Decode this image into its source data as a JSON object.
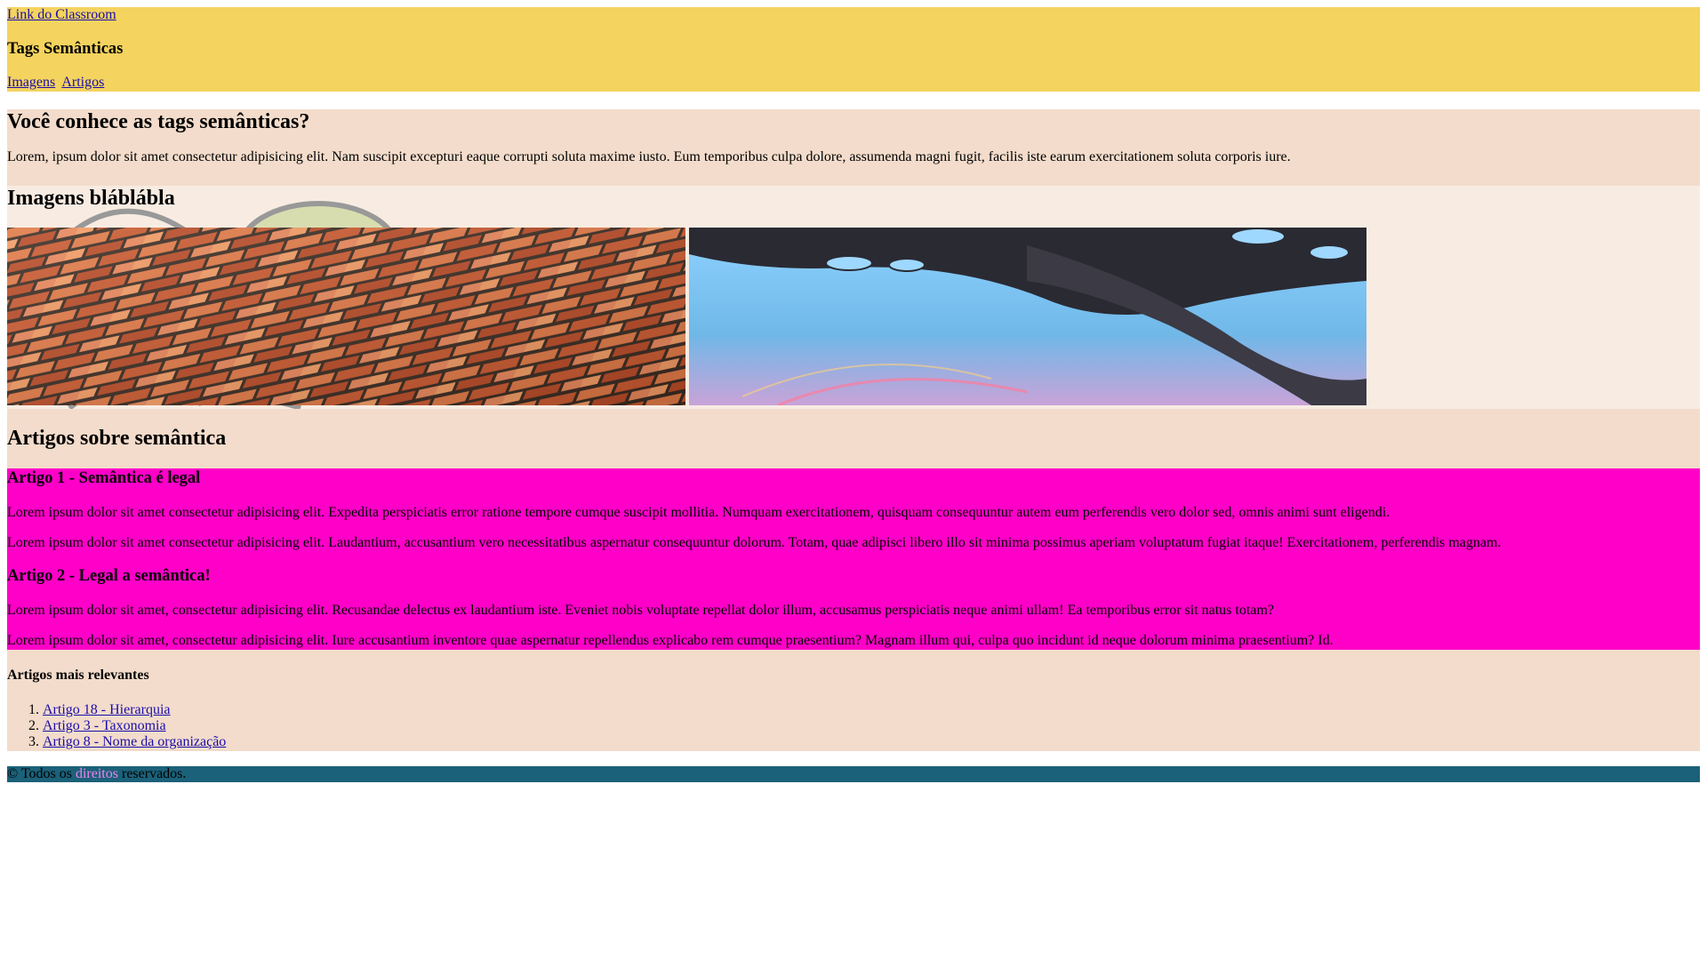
{
  "header": {
    "classroom_link": "Link do Classroom",
    "title": "Tags Semânticas",
    "nav": [
      "Imagens",
      "Artigos"
    ]
  },
  "intro": {
    "heading": "Você conhece as tags semânticas?",
    "text": "Lorem, ipsum dolor sit amet consectetur adipisicing elit. Nam suscipit excepturi eaque corrupti soluta maxime iusto. Eum temporibus culpa dolore, assumenda magni fugit, facilis iste earum exercitationem soluta corporis iure."
  },
  "images": {
    "heading": "Imagens bláblábla"
  },
  "articles": {
    "heading": "Artigos sobre semântica",
    "items": [
      {
        "title": "Artigo 1 - Semântica é legal",
        "paragraphs": [
          "Lorem ipsum dolor sit amet consectetur adipisicing elit. Expedita perspiciatis error ratione tempore cumque suscipit mollitia. Numquam exercitationem, quisquam consequuntur autem eum perferendis vero dolor sed, omnis animi sunt eligendi.",
          "Lorem ipsum dolor sit amet consectetur adipisicing elit. Laudantium, accusantium vero necessitatibus aspernatur consequuntur dolorum. Totam, quae adipisci libero illo sit minima possimus aperiam voluptatum fugiat itaque! Exercitationem, perferendis magnam."
        ]
      },
      {
        "title": "Artigo 2 - Legal a semântica!",
        "paragraphs": [
          "Lorem ipsum dolor sit amet, consectetur adipisicing elit. Recusandae delectus ex laudantium iste. Eveniet nobis voluptate repellat dolor illum, accusamus perspiciatis neque animi ullam! Ea temporibus error sit natus totam?",
          "Lorem ipsum dolor sit amet, consectetur adipisicing elit. Iure accusantium inventore quae aspernatur repellendus explicabo rem cumque praesentium? Magnam illum qui, culpa quo incidunt id neque dolorum minima praesentium? Id."
        ]
      }
    ]
  },
  "aside": {
    "title": "Artigos mais relevantes",
    "links": [
      "Artigo 18 - Hierarquia",
      "Artigo 3 - Taxonomia",
      "Artigo 8 - Nome da organização"
    ]
  },
  "footer": {
    "before": "© Todos os ",
    "link": "direitos",
    "after": " reservados."
  },
  "colors": {
    "header_bg": "#f4d35e",
    "section_bg": "#f3dccb",
    "images_bg": "#f8ece2",
    "article_bg": "#ff00c8",
    "footer_bg": "#1b6179",
    "footer_link": "#ee82ee"
  }
}
